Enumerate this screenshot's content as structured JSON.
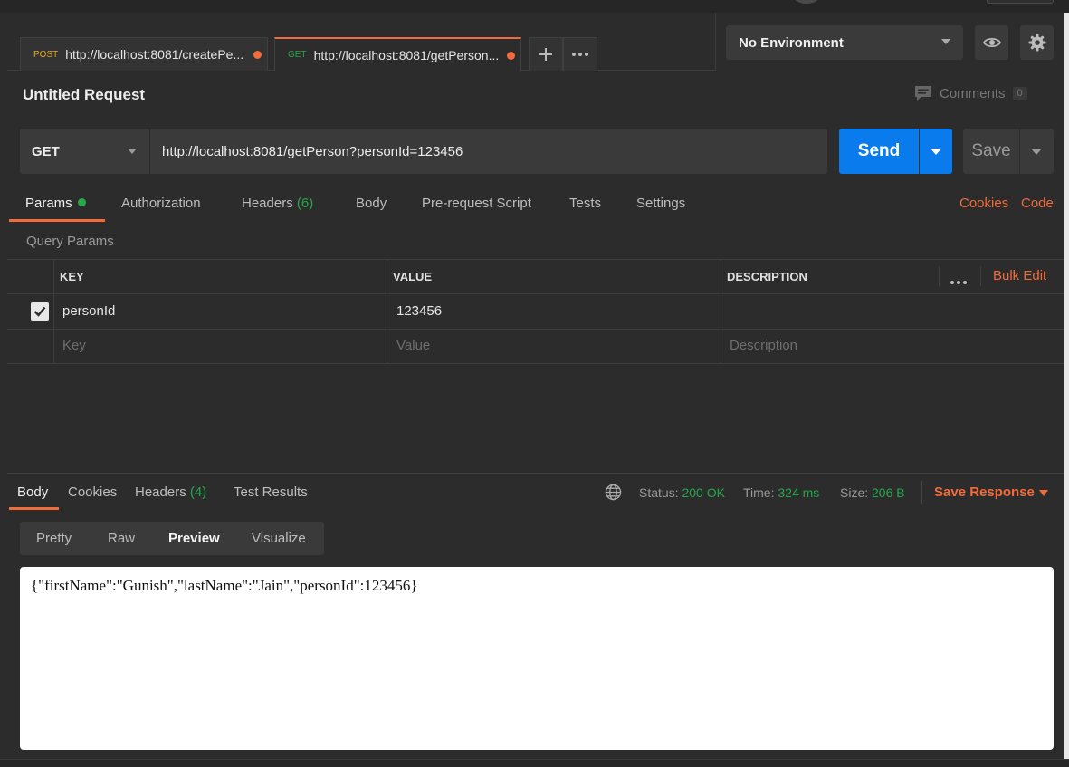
{
  "tabs": [
    {
      "method": "POST",
      "method_color": "#e6a91b",
      "url": "http://localhost:8081/createPe...",
      "active": false
    },
    {
      "method": "GET",
      "method_color": "#25a84a",
      "url": "http://localhost:8081/getPerson...",
      "active": true
    }
  ],
  "tab_actions": {
    "add_icon": "plus-icon",
    "more_icon": "more-horizontal-icon"
  },
  "environment": {
    "selected": "No Environment",
    "eye_icon": "eye-icon",
    "settings_icon": "gear-icon"
  },
  "request": {
    "title": "Untitled Request",
    "comments_label": "Comments",
    "comments_count": "0",
    "method": "GET",
    "url": "http://localhost:8081/getPerson?personId=123456",
    "send_label": "Send",
    "save_label": "Save"
  },
  "request_tabs": {
    "params": "Params",
    "authorization": "Authorization",
    "headers": "Headers",
    "headers_count": "(6)",
    "body": "Body",
    "prerequest": "Pre-request Script",
    "tests": "Tests",
    "settings": "Settings",
    "cookies_link": "Cookies",
    "code_link": "Code"
  },
  "query_params": {
    "label": "Query Params",
    "columns": {
      "key": "KEY",
      "value": "VALUE",
      "description": "DESCRIPTION"
    },
    "bulk_edit": "Bulk Edit",
    "rows": [
      {
        "checked": true,
        "key": "personId",
        "value": "123456",
        "description": ""
      }
    ],
    "placeholders": {
      "key": "Key",
      "value": "Value",
      "description": "Description"
    }
  },
  "response": {
    "tabs": {
      "body": "Body",
      "cookies": "Cookies",
      "headers": "Headers",
      "headers_count": "(4)",
      "test_results": "Test Results"
    },
    "status_label": "Status:",
    "status_value": "200 OK",
    "time_label": "Time:",
    "time_value": "324 ms",
    "size_label": "Size:",
    "size_value": "206 B",
    "save_response": "Save Response",
    "view_modes": {
      "pretty": "Pretty",
      "raw": "Raw",
      "preview": "Preview",
      "visualize": "Visualize"
    },
    "body_text": "{\"firstName\":\"Gunish\",\"lastName\":\"Jain\",\"personId\":123456}"
  },
  "colors": {
    "accent": "#f26b3a",
    "primary": "#097bed",
    "success": "#25a84a"
  }
}
